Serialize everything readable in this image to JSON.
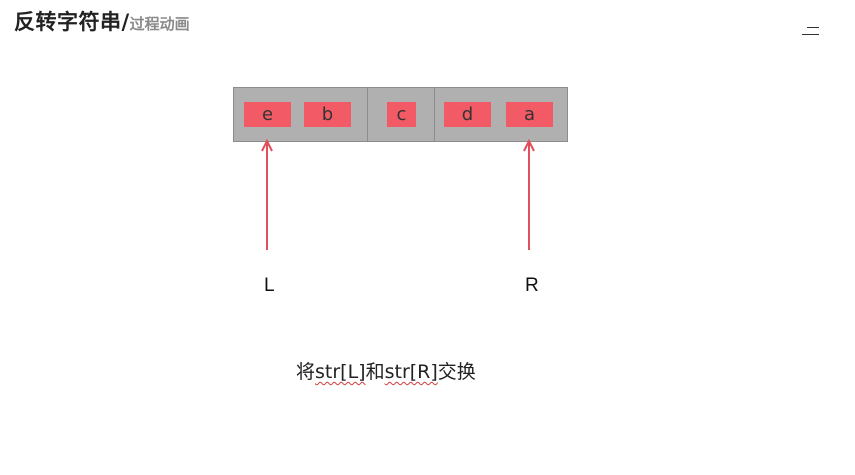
{
  "header": {
    "title": "反转字符串/",
    "subtitle": "过程动画"
  },
  "menu": {
    "icon": "menu-icon"
  },
  "array": {
    "cells": [
      {
        "value": "e"
      },
      {
        "value": "b"
      },
      {
        "value": "c"
      },
      {
        "value": "d"
      },
      {
        "value": "a"
      }
    ],
    "box_color": "#b0b0b0",
    "cell_color": "#f25b66"
  },
  "pointers": {
    "left": {
      "label": "L",
      "index": 0
    },
    "right": {
      "label": "R",
      "index": 4
    },
    "arrow_color": "#e0505c"
  },
  "caption": {
    "prefix": "将",
    "left_expr": "str[L]",
    "middle": "和",
    "right_expr": "str[R]",
    "suffix": "交换"
  }
}
